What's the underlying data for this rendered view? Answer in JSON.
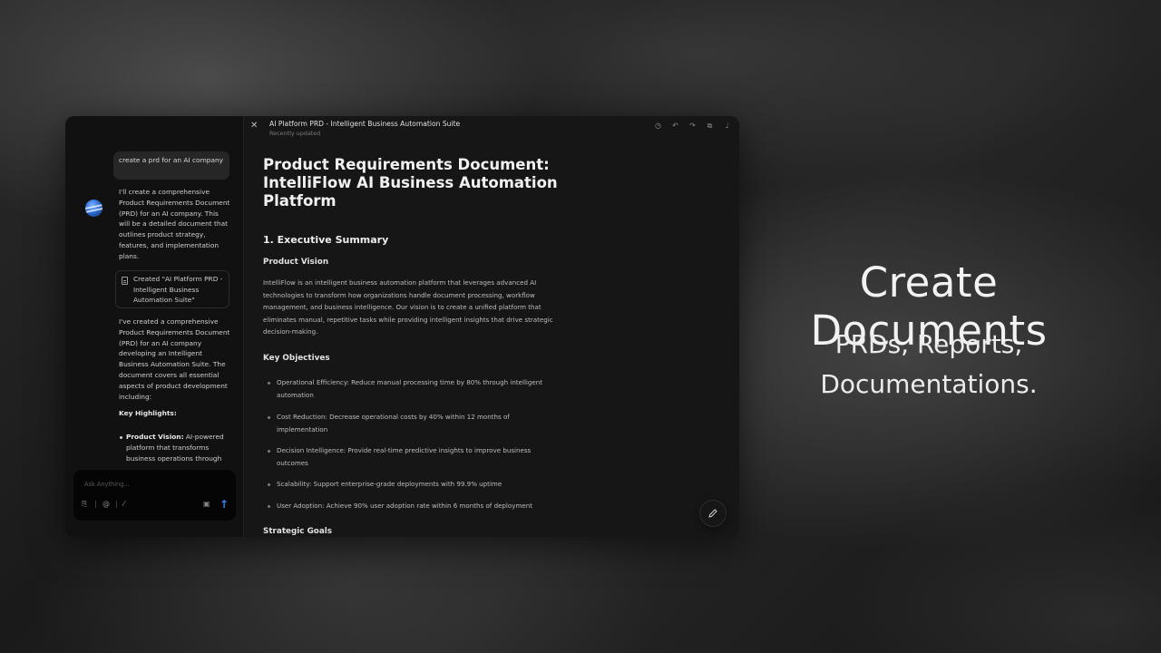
{
  "chat": {
    "user_message": "create a prd for an AI company",
    "assistant_intro": "I'll create a comprehensive Product Requirements Document (PRD) for an AI company. This will be a detailed document that outlines product strategy, features, and implementation plans.",
    "created_card": "Created \"AI Platform PRD - Intelligent Business Automation Suite\"",
    "assistant_followup": "I've created a comprehensive Product Requirements Document (PRD) for an AI company developing an Intelligent Business Automation Suite. The document covers all essential aspects of product development including:",
    "highlights_heading": "Key Highlights:",
    "highlights": [
      {
        "label": "Product Vision:",
        "text": " AI-powered platform that transforms business operations through"
      }
    ],
    "composer_placeholder": "Ask Anything..."
  },
  "document": {
    "header_title": "AI Platform PRD - Intelligent Business Automation Suite",
    "header_subtitle": "Recently updated",
    "title": "Product Requirements Document: IntelliFlow AI Business Automation Platform",
    "section1": "1. Executive Summary",
    "product_vision_heading": "Product Vision",
    "product_vision_text": "IntelliFlow is an intelligent business automation platform that leverages advanced AI technologies to transform how organizations handle document processing, workflow management, and business intelligence. Our vision is to create a unified platform that eliminates manual, repetitive tasks while providing intelligent insights that drive strategic decision-making.",
    "objectives_heading": "Key Objectives",
    "objectives": [
      "Operational Efficiency: Reduce manual processing time by 80% through intelligent automation",
      "Cost Reduction: Decrease operational costs by 40% within 12 months of implementation",
      "Decision Intelligence: Provide real-time predictive insights to improve business outcomes",
      "Scalability: Support enterprise-grade deployments with 99.9% uptime",
      "User Adoption: Achieve 90% user adoption rate within 6 months of deployment"
    ],
    "strategic_goals_heading": "Strategic Goals"
  },
  "promo": {
    "title": "Create Documents",
    "subtitle_line1": "PRDs, Reports,",
    "subtitle_line2": "Documentations."
  },
  "icons": {
    "close": "close-icon",
    "history": "history-icon",
    "undo": "undo-icon",
    "redo": "redo-icon",
    "copy": "copy-icon",
    "mic": "microphone-icon",
    "edit": "pencil-icon",
    "attach": "paperclip-icon",
    "mention": "at-icon",
    "slash": "slash-command-icon",
    "image": "image-icon",
    "send": "send-arrow-icon"
  },
  "colors": {
    "accent": "#3b82f6"
  }
}
